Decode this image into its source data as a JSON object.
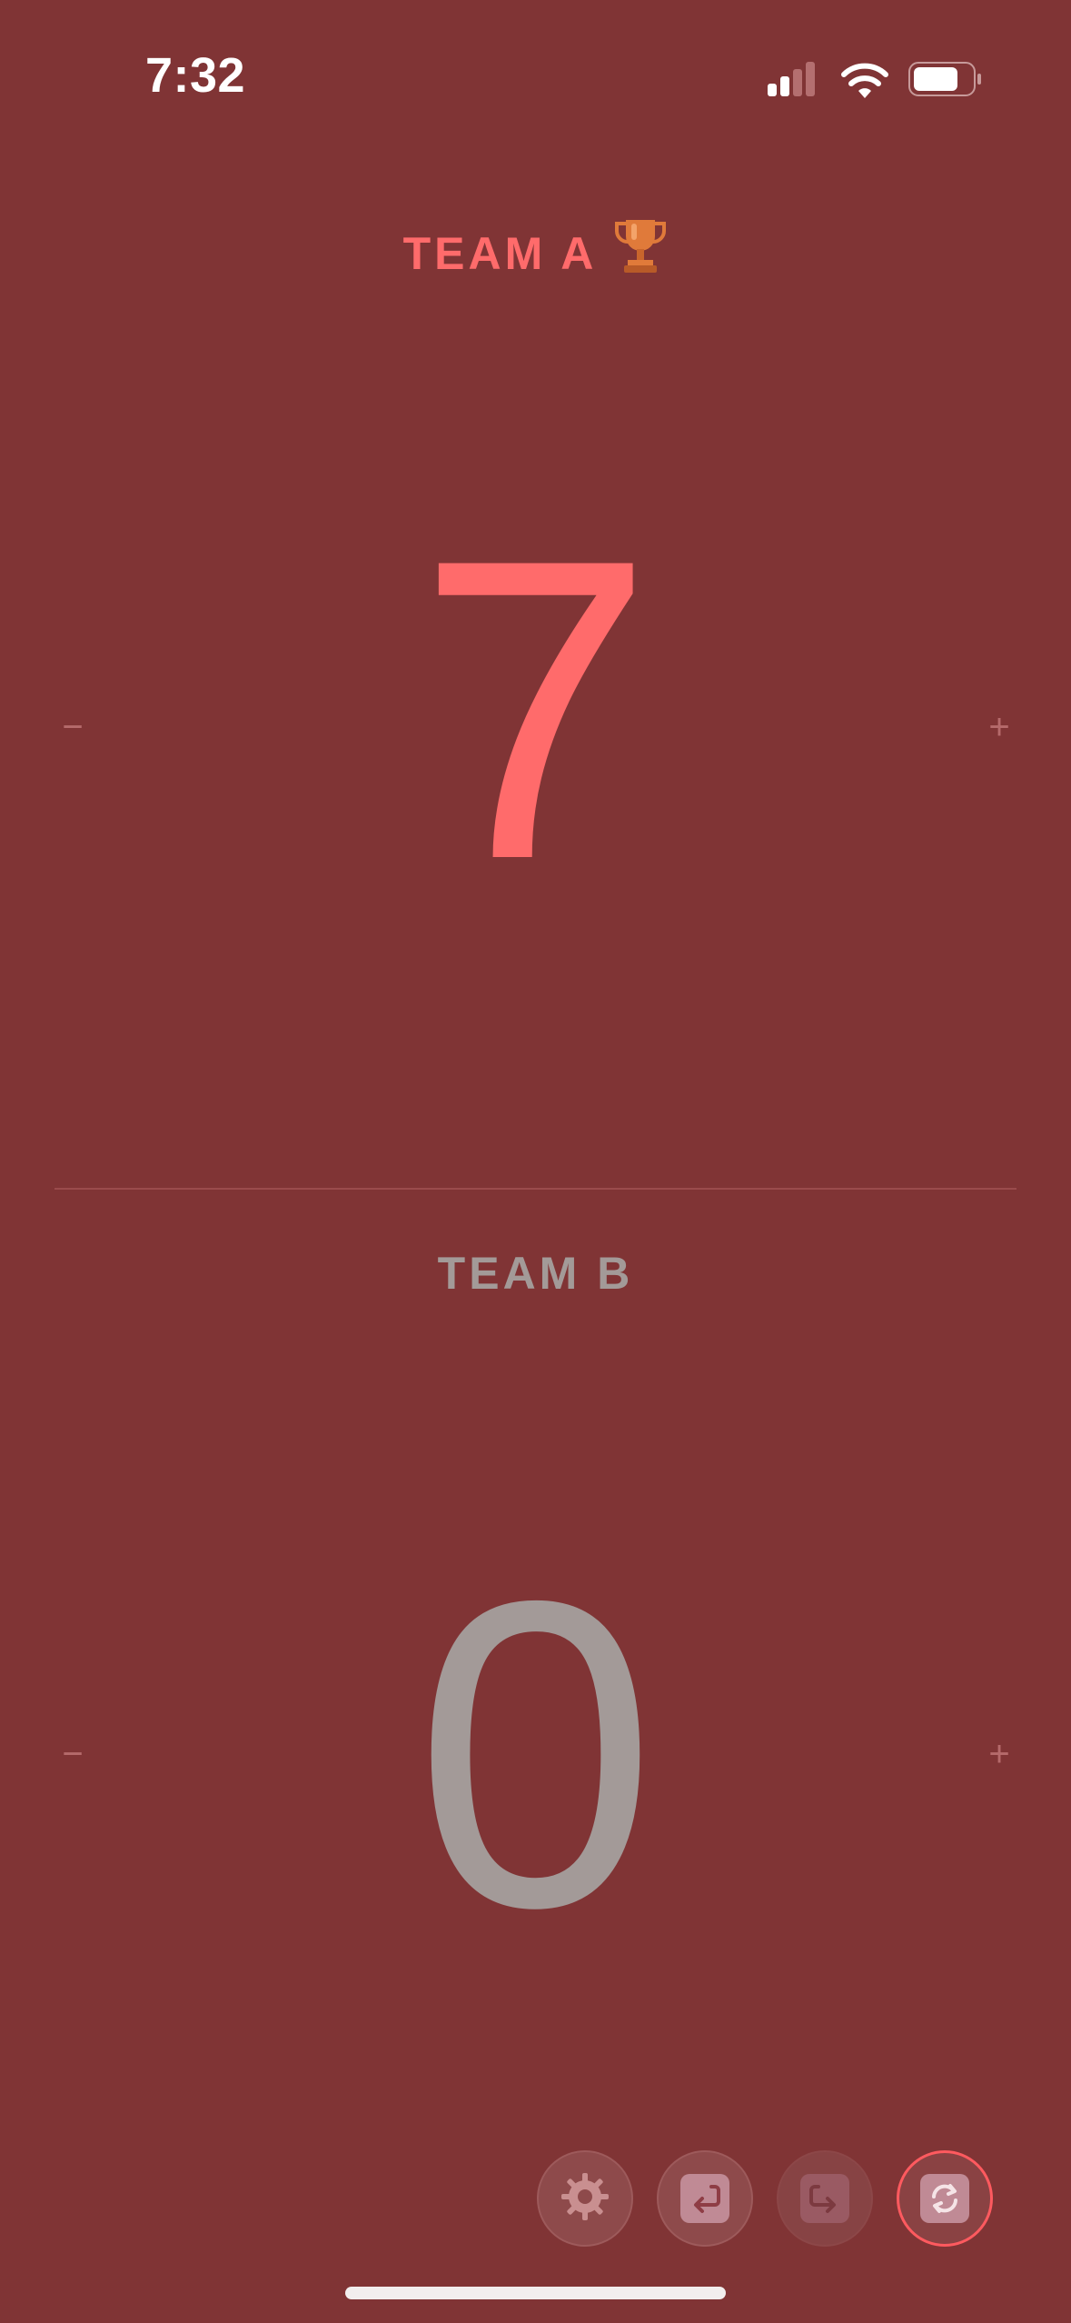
{
  "status_bar": {
    "time": "7:32",
    "signal_icon": "cellular-signal-icon",
    "wifi_icon": "wifi-icon",
    "battery_icon": "battery-icon"
  },
  "team_a": {
    "name": "TEAM A",
    "leader_icon": "trophy-icon",
    "score": "7",
    "minus_label": "−",
    "plus_label": "+"
  },
  "team_b": {
    "name": "TEAM B",
    "score": "0",
    "minus_label": "−",
    "plus_label": "+"
  },
  "toolbar": {
    "buttons": [
      {
        "icon": "gear-icon",
        "state": "enabled"
      },
      {
        "icon": "undo-icon",
        "state": "enabled"
      },
      {
        "icon": "redo-icon",
        "state": "disabled"
      },
      {
        "icon": "swap-icon",
        "state": "active"
      }
    ]
  },
  "colors": {
    "background": "#803435",
    "leading_team": "#ff6b6b",
    "trailing_team": "#a39a98",
    "accent_ring": "#ff5a5f"
  }
}
